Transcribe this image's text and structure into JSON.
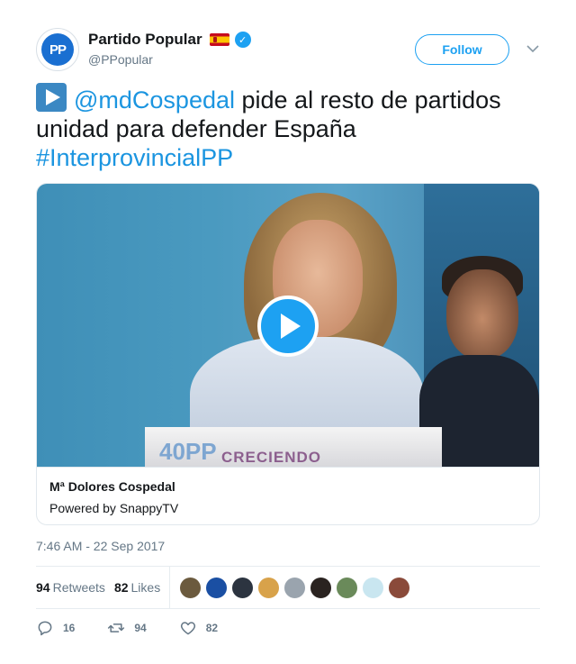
{
  "account": {
    "display_name": "Partido Popular",
    "handle": "@PPopular",
    "avatar_text": "PP",
    "follow_label": "Follow"
  },
  "tweet": {
    "mention": "@mdCospedal",
    "text_rest": " pide al resto de partidos unidad para defender España",
    "hashtag": "#InterprovincialPP"
  },
  "video_card": {
    "podium_logo": "40PP",
    "podium_text": "CRECIENDO",
    "title": "Mª Dolores Cospedal",
    "subtitle": "Powered by SnappyTV"
  },
  "timestamp": "7:46 AM - 22 Sep 2017",
  "stats": {
    "retweets_count": "94",
    "retweets_label": "Retweets",
    "likes_count": "82",
    "likes_label": "Likes"
  },
  "likers": [
    "#6b5a3e",
    "#1a4fa3",
    "#2c3440",
    "#d8a24a",
    "#9aa4ae",
    "#2a2320",
    "#6a8a5a",
    "#c9e6f0",
    "#8a4a3a"
  ],
  "actions": {
    "reply_count": "16",
    "retweet_count": "94",
    "like_count": "82"
  },
  "colors": {
    "accent": "#1da1f2",
    "link": "#1b95e0",
    "muted": "#657786"
  }
}
